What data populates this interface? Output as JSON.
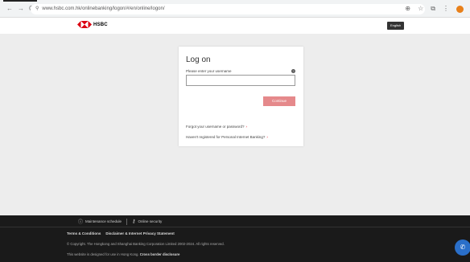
{
  "browser": {
    "url": "www.hsbc.com.hk/onlinebanking/logon/#/en/online/logon/",
    "nav_back": "←",
    "nav_forward": "→",
    "nav_reload": "C",
    "lock_icon": "⚲",
    "right_icons": [
      "⊕",
      "☆",
      "⧉",
      "⋮"
    ]
  },
  "header": {
    "logo_text": "HSBC",
    "brand_color": "#db0011",
    "lang_button": "English"
  },
  "login_card": {
    "title": "Log on",
    "username_label": "Please enter your username",
    "help_icon": "?",
    "username_value": "",
    "continue_label": "Continue",
    "continue_color": "#e5898b",
    "forgot_link": "Forgot your username or password?",
    "register_link": "Haven't registered for Personal Internet Banking?",
    "link_arrow": "›"
  },
  "footer": {
    "maintenance_icon": "ⓘ",
    "maintenance_label": "Maintenance schedule",
    "security_icon": "⚷",
    "security_label": "Online security",
    "terms": "Terms & Conditions",
    "privacy": "Disclaimer & Internet Privacy Statement",
    "copyright": "© Copyright. The Hongkong and Shanghai Banking Corporation Limited 2002-2024. All rights reserved.",
    "disclaimer_text": "This website is designed for use in Hong Kong.",
    "disclaimer_link": "Cross border disclosure"
  },
  "chat": {
    "icon": "✆"
  }
}
